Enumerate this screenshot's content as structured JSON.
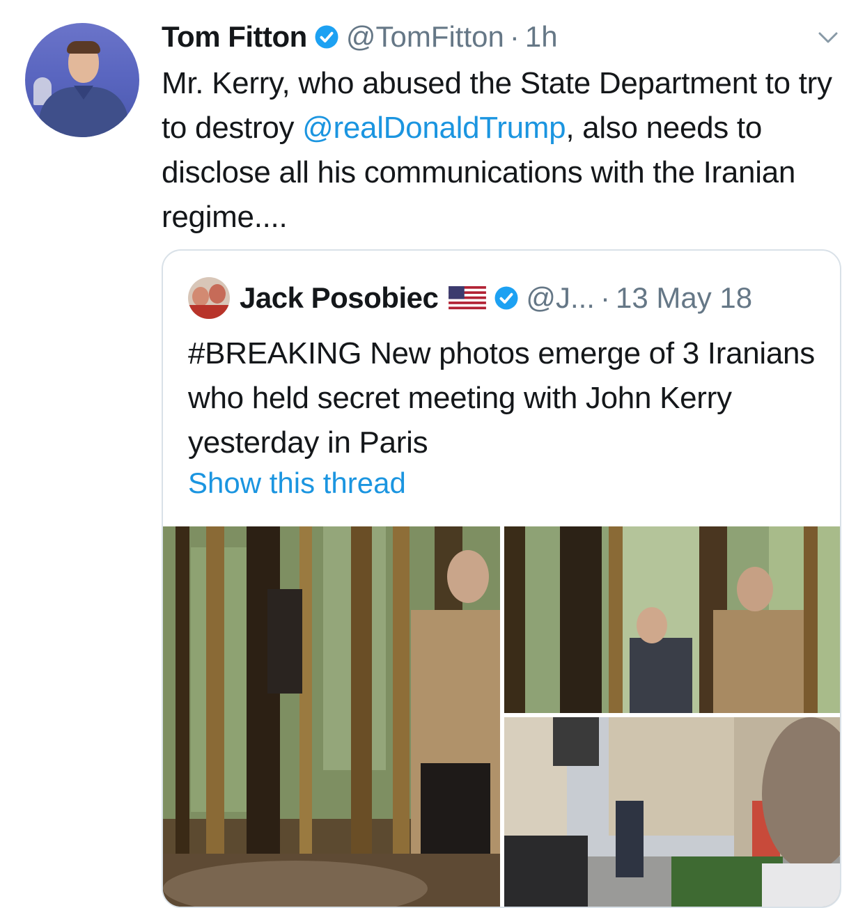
{
  "tweet": {
    "author_name": "Tom Fitton",
    "author_handle": "@TomFitton",
    "separator": "·",
    "time": "1h",
    "text_before": "Mr. Kerry, who abused the State Department to try to destroy ",
    "mention": "@realDonaldTrump",
    "text_after": ", also needs to disclose all his communications with the Iranian regime....",
    "verified": true,
    "menu_icon": "chevron-down-icon"
  },
  "quoted_tweet": {
    "author_name": "Jack Posobiec",
    "author_handle": "@J...",
    "separator": "·",
    "date": "13 May 18",
    "text": "#BREAKING New photos emerge of 3 Iranians who held secret meeting with John Kerry yesterday in Paris",
    "show_thread": "Show this thread",
    "verified": true,
    "flag_icon": "us-flag-icon",
    "photos": [
      "photo-hotel-lobby-door",
      "photo-hotel-entrance",
      "photo-paris-street"
    ]
  },
  "colors": {
    "text": "#14171a",
    "secondary": "#657786",
    "link": "#1b95e0",
    "verified": "#1da1f2",
    "border": "#d9e1e8"
  }
}
